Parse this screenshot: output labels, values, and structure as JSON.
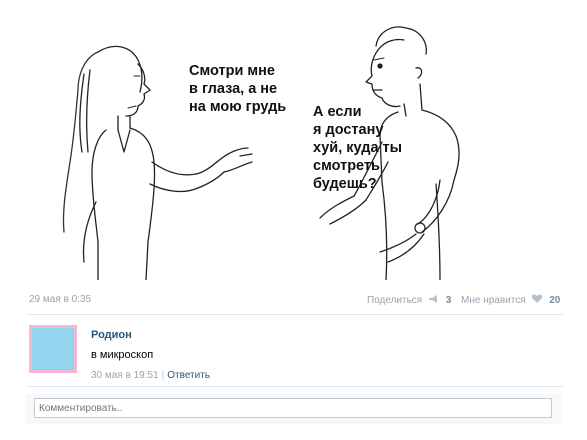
{
  "illustration": {
    "speech_woman": [
      "Смотри мне",
      "в глаза, а не",
      "на мою грудь"
    ],
    "speech_man": [
      "А если",
      "я достану",
      "хуй, куда ты",
      "смотреть",
      "будешь?"
    ]
  },
  "post": {
    "date": "29 мая в 0:35",
    "share_label": "Поделиться",
    "share_count": "3",
    "like_label": "Мне нравится",
    "like_count": "20"
  },
  "comment": {
    "author": "Родион",
    "text": "в микроскоп",
    "date": "30 мая в 19:51",
    "reply_label": "Ответить"
  },
  "comment_input": {
    "placeholder": "Комментировать.."
  },
  "colors": {
    "link": "#2b587a",
    "meta": "#9aa3ad",
    "avatar_border": "#f3b6d3",
    "avatar_fill": "#93d4ef"
  }
}
